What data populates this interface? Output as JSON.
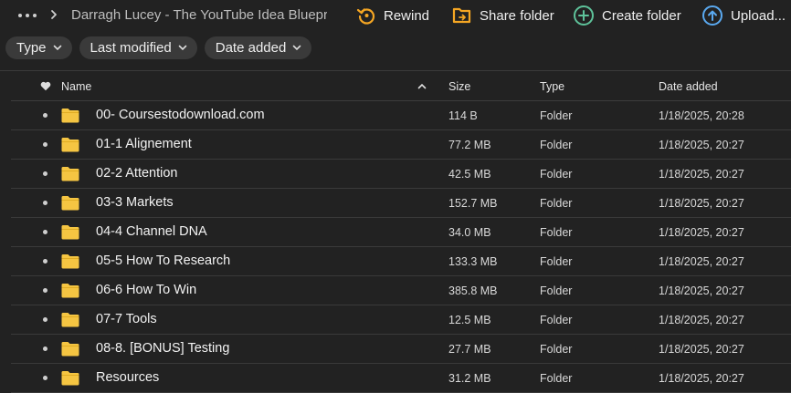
{
  "breadcrumb": {
    "title": "Darragh Lucey - The YouTube Idea Blueprin"
  },
  "actions": {
    "rewind": "Rewind",
    "share": "Share folder",
    "create": "Create folder",
    "upload": "Upload..."
  },
  "filters": [
    "Type",
    "Last modified",
    "Date added"
  ],
  "columns": {
    "name": "Name",
    "size": "Size",
    "type": "Type",
    "date": "Date added"
  },
  "rows": [
    {
      "name": "00- Coursestodownload.com",
      "size": "114 B",
      "type": "Folder",
      "date": "1/18/2025, 20:28"
    },
    {
      "name": "01-1 Alignement",
      "size": "77.2 MB",
      "type": "Folder",
      "date": "1/18/2025, 20:27"
    },
    {
      "name": "02-2 Attention",
      "size": "42.5 MB",
      "type": "Folder",
      "date": "1/18/2025, 20:27"
    },
    {
      "name": "03-3 Markets",
      "size": "152.7 MB",
      "type": "Folder",
      "date": "1/18/2025, 20:27"
    },
    {
      "name": "04-4 Channel DNA",
      "size": "34.0 MB",
      "type": "Folder",
      "date": "1/18/2025, 20:27"
    },
    {
      "name": "05-5 How To Research",
      "size": "133.3 MB",
      "type": "Folder",
      "date": "1/18/2025, 20:27"
    },
    {
      "name": "06-6 How To Win",
      "size": "385.8 MB",
      "type": "Folder",
      "date": "1/18/2025, 20:27"
    },
    {
      "name": "07-7 Tools",
      "size": "12.5 MB",
      "type": "Folder",
      "date": "1/18/2025, 20:27"
    },
    {
      "name": "08-8. [BONUS] Testing",
      "size": "27.7 MB",
      "type": "Folder",
      "date": "1/18/2025, 20:27"
    },
    {
      "name": "Resources",
      "size": "31.2 MB",
      "type": "Folder",
      "date": "1/18/2025, 20:27"
    }
  ],
  "colors": {
    "folder": "#f5c542",
    "accent_rewind": "#f5a623",
    "accent_create": "#5ec29a",
    "accent_upload": "#5aa9f0"
  }
}
